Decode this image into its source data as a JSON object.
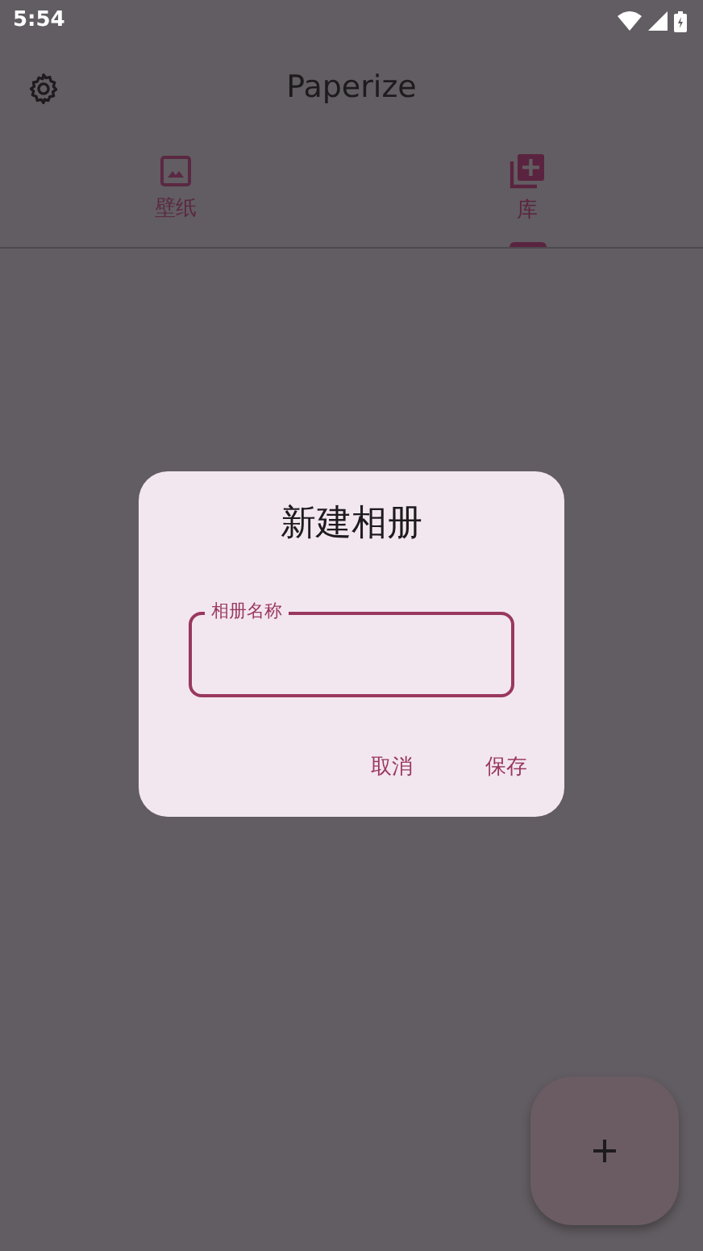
{
  "status_bar": {
    "time": "5:54"
  },
  "app_bar": {
    "title": "Paperize"
  },
  "tabs": [
    {
      "label": "壁纸",
      "kind": "wallpaper",
      "selected": false
    },
    {
      "label": "库",
      "kind": "library",
      "selected": true
    }
  ],
  "dialog": {
    "title": "新建相册",
    "field": {
      "label": "相册名称"
    },
    "buttons": [
      "取消",
      "保存"
    ]
  }
}
